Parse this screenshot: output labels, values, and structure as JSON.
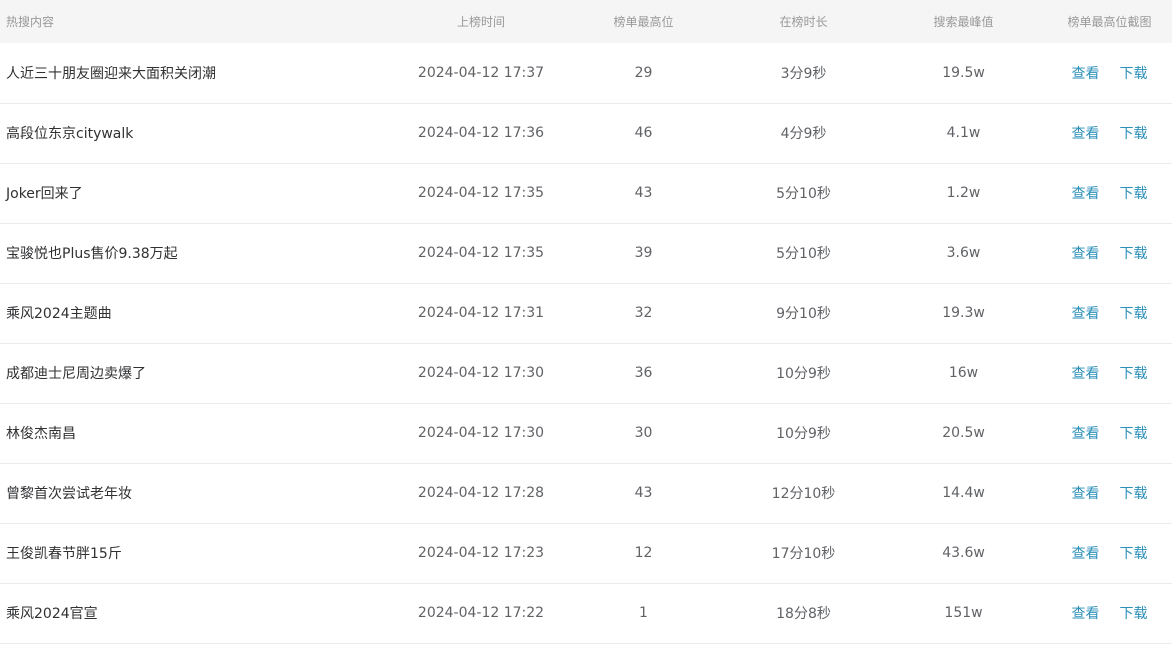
{
  "headers": {
    "title": "热搜内容",
    "time": "上榜时间",
    "rank": "榜单最高位",
    "duration": "在榜时长",
    "peak": "搜索最峰值",
    "screenshot": "榜单最高位截图"
  },
  "actions": {
    "view": "查看",
    "download": "下载"
  },
  "rows": [
    {
      "title": "人近三十朋友圈迎来大面积关闭潮",
      "time": "2024-04-12 17:37",
      "rank": "29",
      "duration": "3分9秒",
      "peak": "19.5w"
    },
    {
      "title": "高段位东京citywalk",
      "time": "2024-04-12 17:36",
      "rank": "46",
      "duration": "4分9秒",
      "peak": "4.1w"
    },
    {
      "title": "Joker回来了",
      "time": "2024-04-12 17:35",
      "rank": "43",
      "duration": "5分10秒",
      "peak": "1.2w"
    },
    {
      "title": "宝骏悦也Plus售价9.38万起",
      "time": "2024-04-12 17:35",
      "rank": "39",
      "duration": "5分10秒",
      "peak": "3.6w"
    },
    {
      "title": "乘风2024主题曲",
      "time": "2024-04-12 17:31",
      "rank": "32",
      "duration": "9分10秒",
      "peak": "19.3w"
    },
    {
      "title": "成都迪士尼周边卖爆了",
      "time": "2024-04-12 17:30",
      "rank": "36",
      "duration": "10分9秒",
      "peak": "16w"
    },
    {
      "title": "林俊杰南昌",
      "time": "2024-04-12 17:30",
      "rank": "30",
      "duration": "10分9秒",
      "peak": "20.5w"
    },
    {
      "title": "曾黎首次尝试老年妆",
      "time": "2024-04-12 17:28",
      "rank": "43",
      "duration": "12分10秒",
      "peak": "14.4w"
    },
    {
      "title": "王俊凯春节胖15斤",
      "time": "2024-04-12 17:23",
      "rank": "12",
      "duration": "17分10秒",
      "peak": "43.6w"
    },
    {
      "title": "乘风2024官宣",
      "time": "2024-04-12 17:22",
      "rank": "1",
      "duration": "18分8秒",
      "peak": "151w"
    }
  ]
}
